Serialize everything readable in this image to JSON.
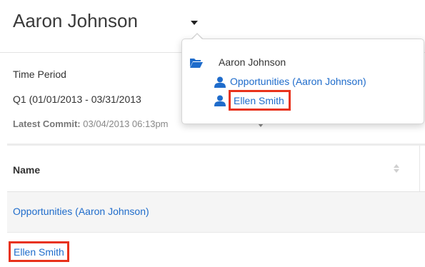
{
  "header": {
    "title": "Aaron Johnson"
  },
  "time_period": {
    "label": "Time Period",
    "value": "Q1 (01/01/2013 - 03/31/2013",
    "latest_commit_label": "Latest Commit:",
    "latest_commit_value": "03/04/2013 06:13pm"
  },
  "table": {
    "columns": [
      "Name"
    ],
    "rows": [
      {
        "name": "Opportunities (Aaron Johnson)"
      },
      {
        "name": "Ellen Smith"
      }
    ]
  },
  "dropdown": {
    "root_label": "Aaron Johnson",
    "items": [
      {
        "label": "Opportunities (Aaron Johnson)",
        "icon": "person-icon"
      },
      {
        "label": "Ellen Smith",
        "icon": "person-icon",
        "highlighted": true
      }
    ],
    "root_icon": "folder-open-icon"
  },
  "colors": {
    "link": "#1f6ccb",
    "icon": "#1f6ccb",
    "highlight_box": "#e8321b",
    "row_bg": "#f5f5f5"
  }
}
